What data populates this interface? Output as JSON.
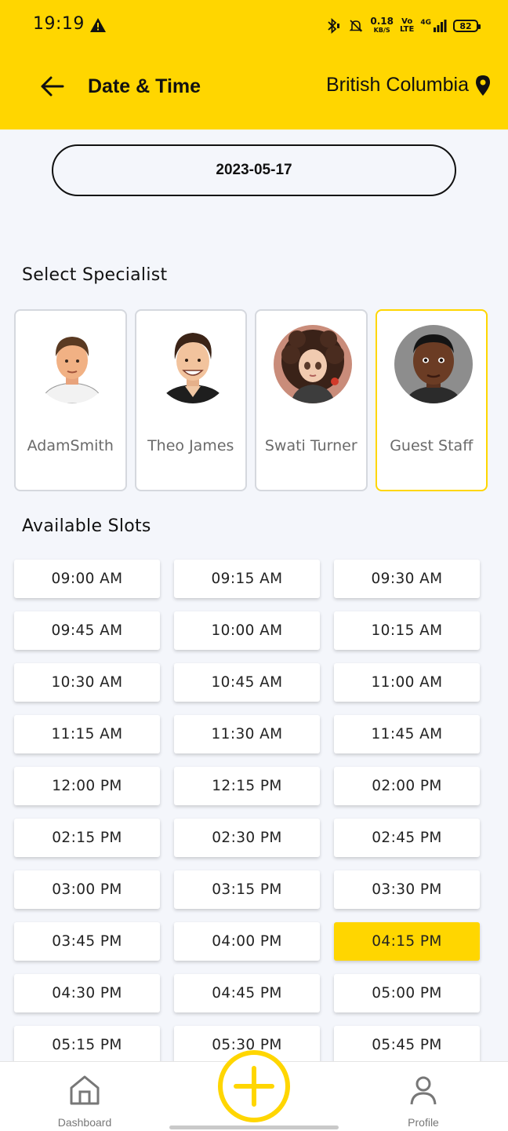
{
  "status_bar": {
    "time": "19:19",
    "net_speed_value": "0.18",
    "net_speed_unit": "KB/S",
    "volte_top": "Vo",
    "volte_bottom": "LTE",
    "network_type": "4G",
    "battery": "82"
  },
  "header": {
    "title": "Date & Time",
    "location": "British Columbia"
  },
  "date_selector": {
    "value": "2023-05-17"
  },
  "specialists_section": {
    "title": "Select Specialist",
    "items": [
      {
        "name": "AdamSmith",
        "selected": false
      },
      {
        "name": "Theo James",
        "selected": false
      },
      {
        "name": "Swati Turner",
        "selected": false
      },
      {
        "name": "Guest Staff",
        "selected": true
      }
    ]
  },
  "slots_section": {
    "title": "Available Slots",
    "slots": [
      "09:00 AM",
      "09:15 AM",
      "09:30 AM",
      "09:45 AM",
      "10:00 AM",
      "10:15 AM",
      "10:30 AM",
      "10:45 AM",
      "11:00 AM",
      "11:15 AM",
      "11:30 AM",
      "11:45 AM",
      "12:00 PM",
      "12:15 PM",
      "02:00 PM",
      "02:15 PM",
      "02:30 PM",
      "02:45 PM",
      "03:00 PM",
      "03:15 PM",
      "03:30 PM",
      "03:45 PM",
      "04:00 PM",
      "04:15 PM",
      "04:30 PM",
      "04:45 PM",
      "05:00 PM",
      "05:15 PM",
      "05:30 PM",
      "05:45 PM"
    ],
    "selected_slot": "04:15 PM"
  },
  "bottom_nav": {
    "dashboard_label": "Dashboard",
    "profile_label": "Profile"
  },
  "colors": {
    "accent": "#ffd600",
    "background": "#f4f6fb"
  }
}
